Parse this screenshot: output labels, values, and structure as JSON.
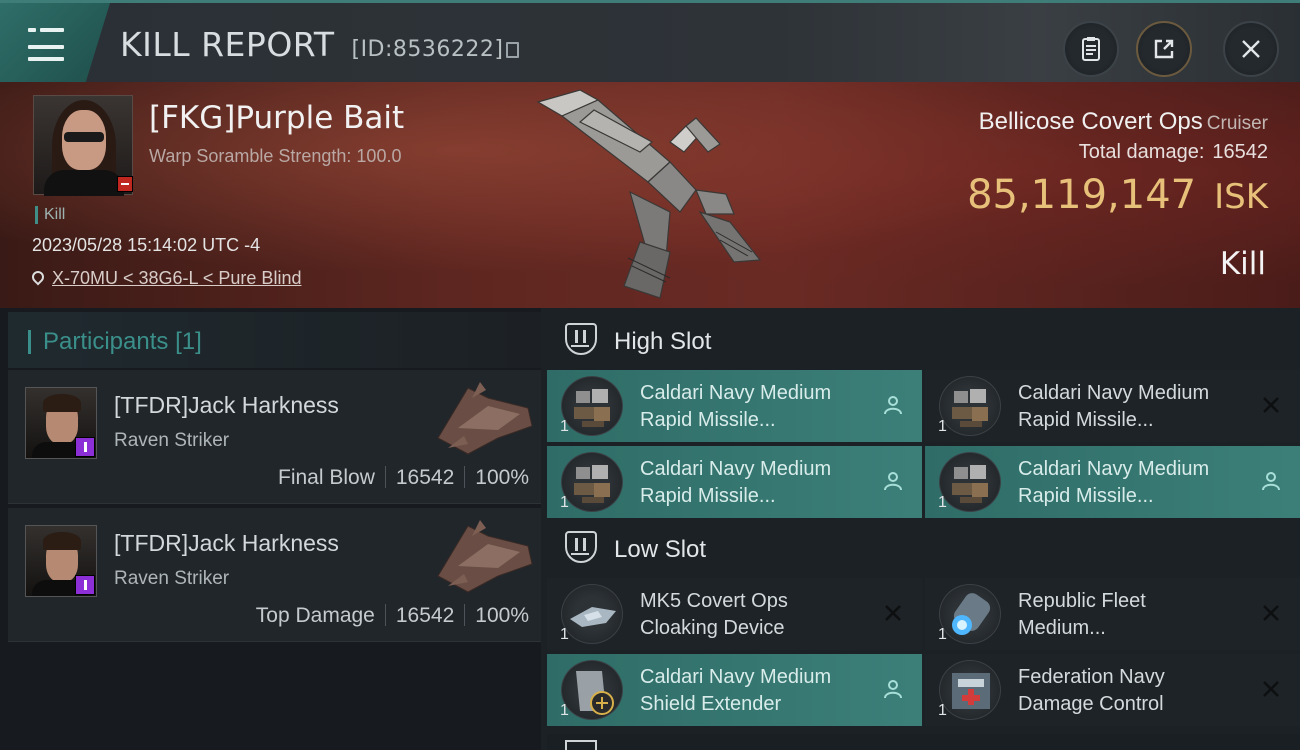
{
  "header": {
    "title": "KILL REPORT",
    "report_id": "[ID:8536222]"
  },
  "victim": {
    "name": "[FKG]Purple Bait",
    "warp_scramble": "Warp Soramble Strength: 100.0",
    "kill_tag": "Kill",
    "datetime": "2023/05/28 15:14:02 UTC -4",
    "location": "X-70MU < 38G6-L < Pure Blind",
    "ship_name": "Bellicose Covert Ops",
    "ship_class": "Cruiser",
    "total_damage_label": "Total damage:",
    "total_damage": "16542",
    "isk_value": "85,119,147",
    "isk_unit": "ISK",
    "result": "Kill"
  },
  "participants": {
    "title": "Participants",
    "count": "[1]",
    "items": [
      {
        "name": "[TFDR]Jack Harkness",
        "ship": "Raven Striker",
        "role": "Final Blow",
        "damage": "16542",
        "percent": "100%"
      },
      {
        "name": "[TFDR]Jack Harkness",
        "ship": "Raven Striker",
        "role": "Top Damage",
        "damage": "16542",
        "percent": "100%"
      }
    ]
  },
  "slots": {
    "high": {
      "title": "High Slot",
      "modules": [
        {
          "line1": "Caldari Navy Medium",
          "line2": "Rapid Missile...",
          "qty": "1",
          "state": "active",
          "action": "person-icon"
        },
        {
          "line1": "Caldari Navy Medium",
          "line2": "Rapid Missile...",
          "qty": "1",
          "state": "dark",
          "action": "close-icon"
        },
        {
          "line1": "Caldari Navy Medium",
          "line2": "Rapid Missile...",
          "qty": "1",
          "state": "active",
          "action": "person-icon"
        },
        {
          "line1": "Caldari Navy Medium",
          "line2": "Rapid Missile...",
          "qty": "1",
          "state": "active",
          "action": "person-icon"
        }
      ]
    },
    "low": {
      "title": "Low Slot",
      "modules": [
        {
          "line1": "MK5 Covert Ops",
          "line2": "Cloaking Device",
          "qty": "1",
          "state": "dark",
          "action": "close-icon"
        },
        {
          "line1": "Republic Fleet",
          "line2": "Medium...",
          "qty": "1",
          "state": "dark",
          "action": "close-icon"
        },
        {
          "line1": "Caldari Navy Medium",
          "line2": "Shield Extender",
          "qty": "1",
          "state": "active",
          "action": "person-icon"
        },
        {
          "line1": "Federation Navy",
          "line2": "Damage Control",
          "qty": "1",
          "state": "dark",
          "action": "close-icon"
        }
      ]
    }
  },
  "colors": {
    "accent_teal": "#3c7f79",
    "isk_gold": "#e7c17a",
    "badge_purple": "#8c2fd6",
    "badge_red": "#c0281f"
  }
}
